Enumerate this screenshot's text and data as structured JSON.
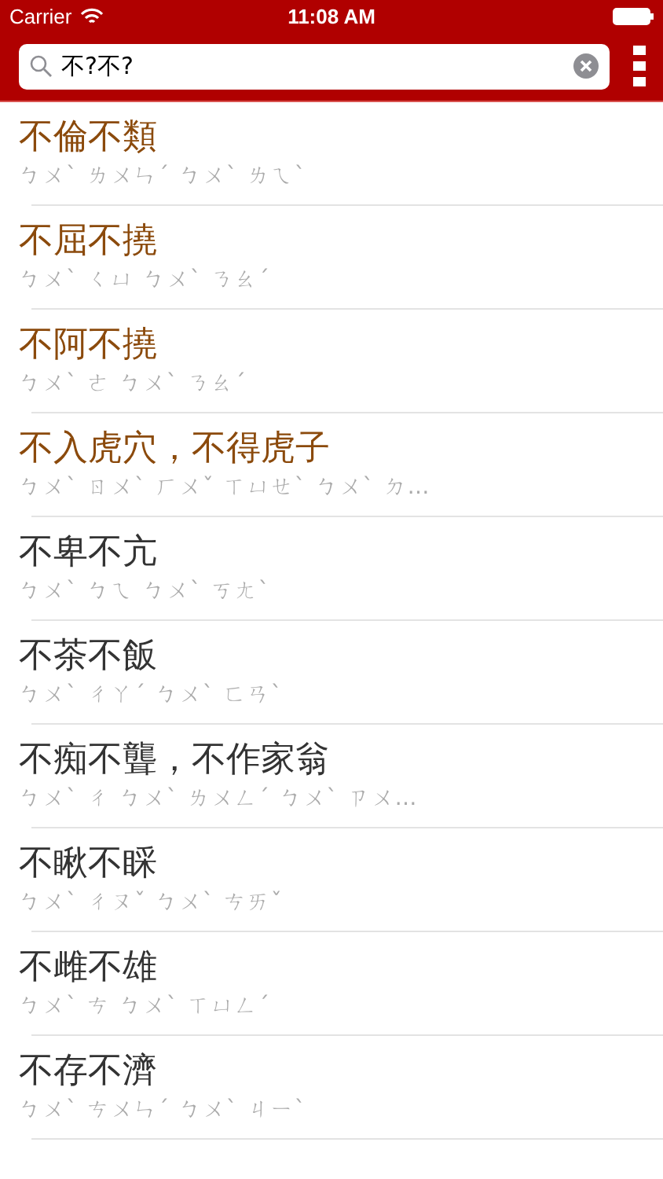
{
  "status_bar": {
    "carrier": "Carrier",
    "time": "11:08 AM"
  },
  "search": {
    "value": "不?不?"
  },
  "results": [
    {
      "title": "不倫不類",
      "reading": "ㄅㄨˋ ㄌㄨㄣˊ ㄅㄨˋ ㄌㄟˋ",
      "highlighted": true
    },
    {
      "title": "不屈不撓",
      "reading": "ㄅㄨˋ ㄑㄩ ㄅㄨˋ ㄋㄠˊ",
      "highlighted": true
    },
    {
      "title": "不阿不撓",
      "reading": "ㄅㄨˋ ㄜ ㄅㄨˋ ㄋㄠˊ",
      "highlighted": true
    },
    {
      "title": "不入虎穴，不得虎子",
      "reading": "ㄅㄨˋ ㄖㄨˋ ㄏㄨˇ ㄒㄩㄝˋ ㄅㄨˋ ㄉ…",
      "highlighted": true
    },
    {
      "title": "不卑不亢",
      "reading": "ㄅㄨˋ ㄅㄟ ㄅㄨˋ ㄎㄤˋ",
      "highlighted": false
    },
    {
      "title": "不茶不飯",
      "reading": "ㄅㄨˋ ㄔㄚˊ ㄅㄨˋ ㄈㄢˋ",
      "highlighted": false
    },
    {
      "title": "不痴不聾，不作家翁",
      "reading": "ㄅㄨˋ ㄔ ㄅㄨˋ ㄌㄨㄥˊ ㄅㄨˋ ㄗㄨ…",
      "highlighted": false
    },
    {
      "title": "不瞅不睬",
      "reading": "ㄅㄨˋ ㄔㄡˇ ㄅㄨˋ ㄘㄞˇ",
      "highlighted": false
    },
    {
      "title": "不雌不雄",
      "reading": "ㄅㄨˋ ㄘ ㄅㄨˋ ㄒㄩㄥˊ",
      "highlighted": false
    },
    {
      "title": "不存不濟",
      "reading": "ㄅㄨˋ ㄘㄨㄣˊ ㄅㄨˋ ㄐㄧˋ",
      "highlighted": false
    }
  ]
}
